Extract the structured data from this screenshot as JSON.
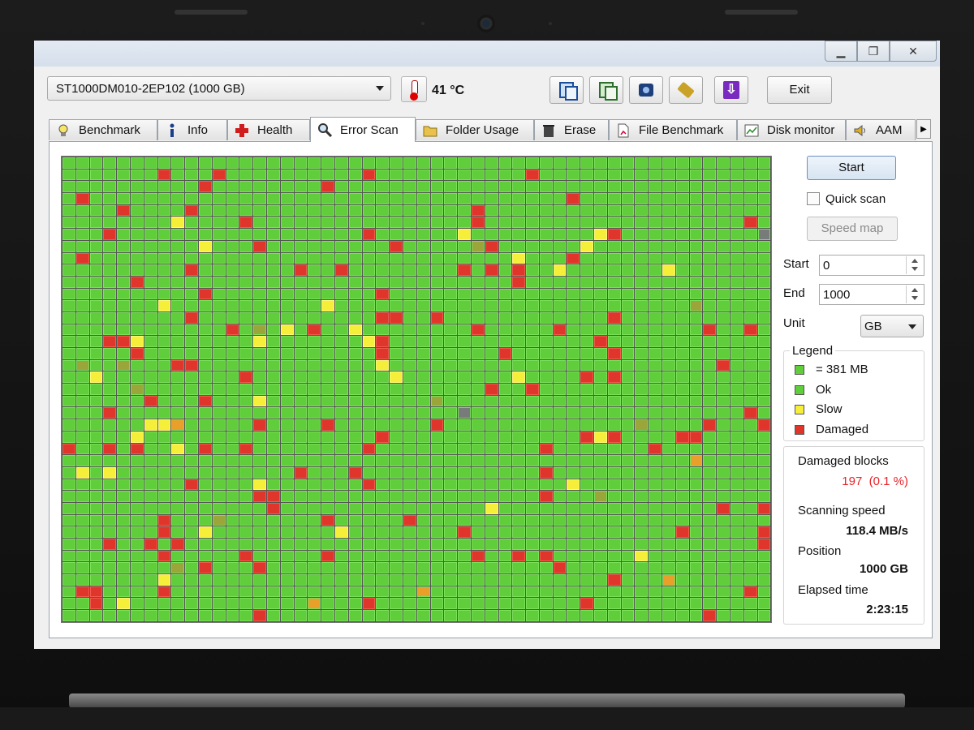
{
  "toolbar": {
    "drive": "ST1000DM010-2EP102 (1000 GB)",
    "temperature": "41 °C",
    "exit_label": "Exit",
    "buttons": [
      "copy-text-icon",
      "copy-image-icon",
      "screenshot-icon",
      "tag-icon",
      "download-icon"
    ]
  },
  "window_controls": {
    "minimize": "▁",
    "restore": "❐",
    "close": "✕"
  },
  "tabs": [
    {
      "label": "Benchmark",
      "icon": "lightbulb-icon"
    },
    {
      "label": "Info",
      "icon": "info-icon"
    },
    {
      "label": "Health",
      "icon": "health-cross-icon"
    },
    {
      "label": "Error Scan",
      "icon": "magnifier-icon",
      "active": true
    },
    {
      "label": "Folder Usage",
      "icon": "folder-icon"
    },
    {
      "label": "Erase",
      "icon": "trash-icon"
    },
    {
      "label": "File Benchmark",
      "icon": "file-benchmark-icon"
    },
    {
      "label": "Disk monitor",
      "icon": "disk-monitor-icon"
    },
    {
      "label": "AAM",
      "icon": "speaker-icon"
    }
  ],
  "scan": {
    "start_label": "Start",
    "quick_scan_label": "Quick scan",
    "quick_scan_checked": false,
    "speed_map_label": "Speed map",
    "start_field_label": "Start",
    "start_value": "0",
    "end_field_label": "End",
    "end_value": "1000",
    "unit_label": "Unit",
    "unit_value": "GB"
  },
  "legend": {
    "title": "Legend",
    "block_size": "=  381 MB",
    "ok": "Ok",
    "slow": "Slow",
    "damaged": "Damaged",
    "colors": {
      "ok": "#5fce3a",
      "slow": "#f5ef3a",
      "damaged": "#e0352a"
    }
  },
  "stats": {
    "damaged_label": "Damaged blocks",
    "damaged_value": "197  (0.1 %)",
    "speed_label": "Scanning speed",
    "speed_value": "118.4 MB/s",
    "position_label": "Position",
    "position_value": "1000 GB",
    "elapsed_label": "Elapsed time",
    "elapsed_value": "2:23:15"
  }
}
